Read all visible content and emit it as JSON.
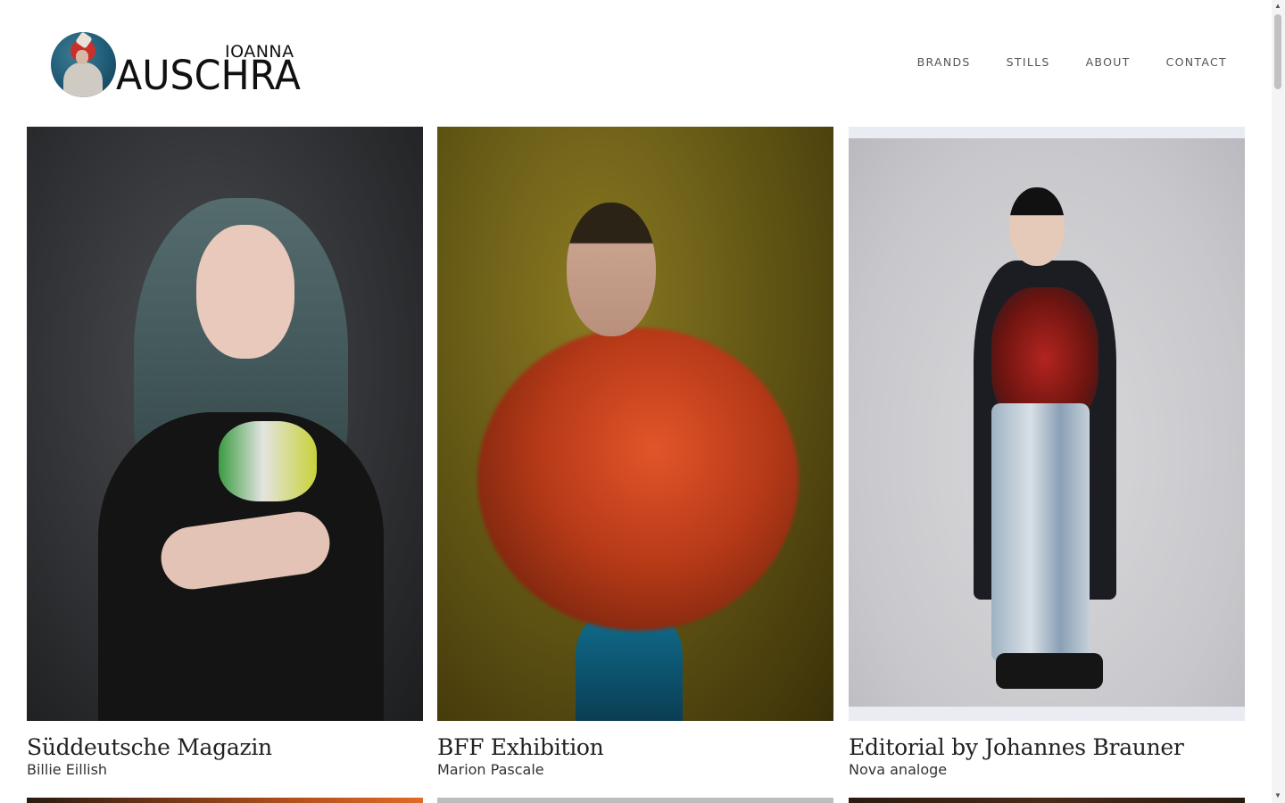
{
  "brand": {
    "first_name": "IOANNA",
    "last_name": "AUSCHRA"
  },
  "nav": {
    "items": [
      {
        "label": "BRANDS"
      },
      {
        "label": "STILLS"
      },
      {
        "label": "ABOUT"
      },
      {
        "label": "CONTACT"
      }
    ]
  },
  "gallery": {
    "items": [
      {
        "title": "Süddeutsche Magazin",
        "subtitle": "Billie Eillish"
      },
      {
        "title": "BFF Exhibition",
        "subtitle": "Marion Pascale"
      },
      {
        "title": "Editorial by Johannes Brauner",
        "subtitle": "Nova analoge"
      }
    ]
  },
  "colors": {
    "text": "#222222",
    "nav_text": "#555555",
    "background": "#ffffff"
  },
  "icons": {
    "scroll_up": "scroll-up-arrow-icon",
    "scroll_down": "scroll-down-arrow-icon"
  }
}
